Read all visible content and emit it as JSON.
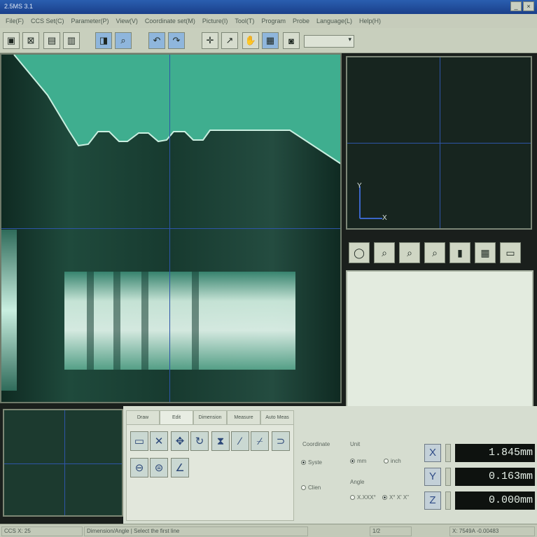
{
  "window": {
    "title": "2.5MS 3.1",
    "buttons": [
      "_",
      "×"
    ]
  },
  "menu": [
    "File(F)",
    "CCS Set(C)",
    "Parameter(P)",
    "View(V)",
    "Coordinate set(M)",
    "Picture(I)",
    "Tool(T)",
    "Program",
    "Probe",
    "Language(L)",
    "Help(H)"
  ],
  "toolbar": {
    "dropdown_value": "▾"
  },
  "tabs": [
    "Draw",
    "Edit",
    "Dimension",
    "Measure",
    "Auto Meas"
  ],
  "coordinate": {
    "label": "Coordinate",
    "option1": "Syste",
    "option2": "Clien"
  },
  "unit": {
    "label": "Unit",
    "option1": "mm",
    "option2": "inch"
  },
  "angle": {
    "label": "Angle",
    "option1": "X.XXX°",
    "option2": "X° X' X\""
  },
  "dro": {
    "x_label": "X",
    "x_value": "1.845mm",
    "y_label": "Y",
    "y_value": "0.163mm",
    "z_label": "Z",
    "z_value": "0.000mm"
  },
  "nav_axes": {
    "y": "Y",
    "x": "X"
  },
  "status": {
    "left": "CCS X: 25",
    "message": "Dimension/Angle | Select the first line",
    "page": "1/2",
    "coords": "X: 7549A -0.00483"
  },
  "colors": {
    "cross": "#2e55a8",
    "dro_bg": "#0e120f",
    "dro_text": "#e5efe7"
  }
}
